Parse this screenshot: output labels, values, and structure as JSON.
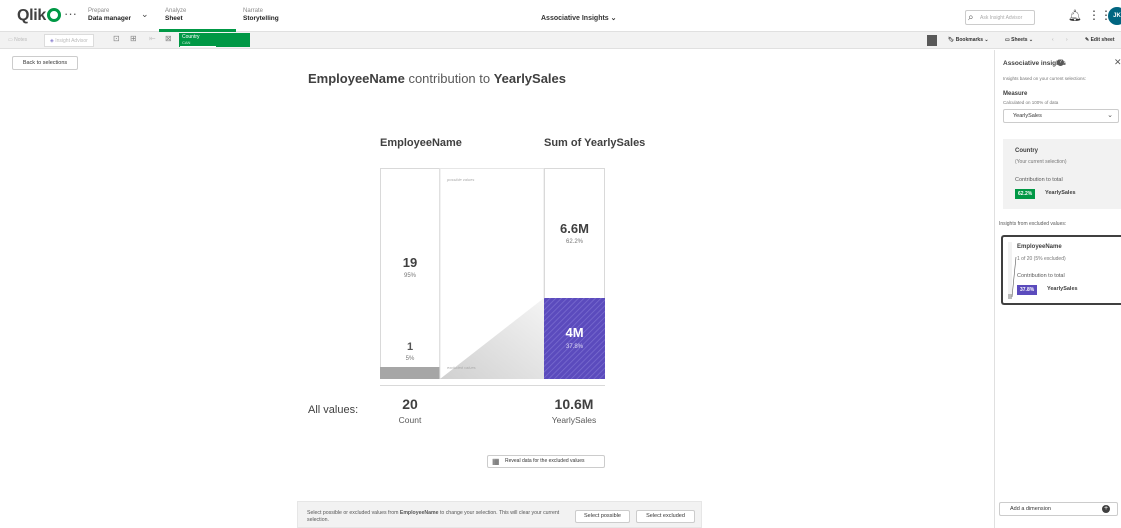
{
  "nav": {
    "logo": "Qlik",
    "more": "···",
    "prepare": {
      "label": "Prepare",
      "value": "Data manager"
    },
    "analyze": {
      "label": "Analyze",
      "value": "Sheet"
    },
    "narrate": {
      "label": "Narrate",
      "value": "Storytelling"
    },
    "app_title": "Associative Insights",
    "search_placeholder": "Ask Insight Advisor",
    "avatar": "JK"
  },
  "toolbar": {
    "notes": "Notes",
    "insight_advisor": "Insight Advisor",
    "selection_field": "Country",
    "selection_value": "CAN",
    "bookmarks": "Bookmarks",
    "sheets": "Sheets",
    "edit_sheet": "Edit sheet"
  },
  "main": {
    "back": "Back to selections",
    "title_dim": "EmployeeName",
    "title_mid": " contribution to ",
    "title_measure": "YearlySales",
    "col_dim": "EmployeeName",
    "col_measure": "Sum of YearlySales",
    "possible_label": "possible values",
    "excluded_label": "excluded values",
    "dim_possible_count": "19",
    "dim_possible_pct": "95%",
    "dim_excluded_count": "1",
    "dim_excluded_pct": "5%",
    "measure_possible": "6.6M",
    "measure_possible_pct": "62.2%",
    "measure_excluded": "4M",
    "measure_excluded_pct": "37.8%",
    "all_values": "All values:",
    "total_count": "20",
    "total_count_label": "Count",
    "total_measure": "10.6M",
    "total_measure_label": "YearlySales",
    "reveal": "Reveal data for the excluded values",
    "bottom_text_1": "Select possible or excluded values from ",
    "bottom_text_bold": "EmployeeName",
    "bottom_text_2": " to change your selection. This will clear your current selection.",
    "select_possible": "Select possible",
    "select_excluded": "Select excluded"
  },
  "panel": {
    "title": "Associative insights",
    "subtitle": "Insights based on your current selections:",
    "measure_title": "Measure",
    "measure_sub": "Calculated on 100% of data",
    "measure_value": "YearlySales",
    "card1": {
      "title": "Country",
      "sub": "(Your current selection)",
      "contrib": "Contribution to total",
      "badge": "62.2%",
      "badge_label": "YearlySales"
    },
    "excluded_heading": "Insights from excluded values:",
    "card2": {
      "title": "EmployeeName",
      "sub": "1 of 20 (5% excluded)",
      "contrib": "Contribution to total",
      "badge": "37.8%",
      "badge_label": "YearlySales"
    },
    "add_dimension": "Add a dimension"
  },
  "colors": {
    "qlik_green": "#009845",
    "excluded_purple": "#5b4bbd",
    "possible_gray": "#a6a6a6"
  }
}
